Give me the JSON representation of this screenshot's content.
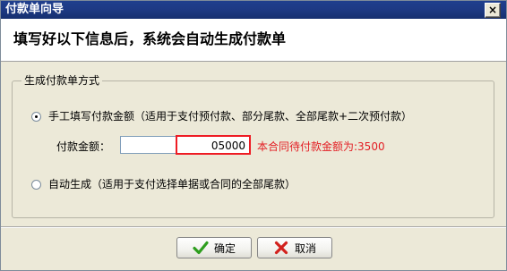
{
  "window": {
    "title": "付款单向导",
    "close_glyph": "×"
  },
  "banner": {
    "text": "填写好以下信息后，系统会自动生成付款单"
  },
  "group": {
    "legend": "生成付款单方式",
    "options": [
      {
        "label": "手工填写付款金额（适用于支付预付款、部分尾款、全部尾款+二次预付款）",
        "selected": true
      },
      {
        "label": "自动生成（适用于支付选择单据或合同的全部尾款）",
        "selected": false
      }
    ],
    "amount": {
      "label": "付款金额：",
      "value": "05000",
      "hint": "本合同待付款金额为:3500"
    }
  },
  "buttons": {
    "ok_label": "确定",
    "ok_icon": "checkmark-icon",
    "cancel_label": "取消",
    "cancel_icon": "x-cross-icon"
  },
  "colors": {
    "titlebar": "#1e3a85",
    "dialog_bg": "#ece9d8",
    "highlight_border": "#ee1c24",
    "hint_text": "#e31e24",
    "ok_icon": "#2e9e1e",
    "cancel_icon": "#d2211d"
  }
}
